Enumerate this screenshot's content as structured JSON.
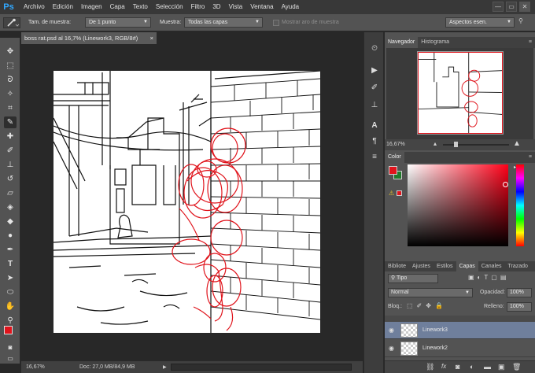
{
  "menubar": {
    "logo": "Ps",
    "items": [
      "Archivo",
      "Edición",
      "Imagen",
      "Capa",
      "Texto",
      "Selección",
      "Filtro",
      "3D",
      "Vista",
      "Ventana",
      "Ayuda"
    ],
    "minimize": "—",
    "restore": "▭",
    "close": "✕"
  },
  "options": {
    "sample_size_label": "Tam. de muestra:",
    "sample_size_value": "De 1 punto",
    "sample_label": "Muestra:",
    "sample_value": "Todas las capas",
    "show_ring_label": "Mostrar aro de muestra",
    "workspace_value": "Aspectos esen."
  },
  "document": {
    "tab_title": "boss rat.psd al 16,7% (Linework3, RGB/8#)",
    "tab_close": "×",
    "zoom": "16,67%",
    "doc_info": "Doc: 27,0 MB/84,9 MB",
    "status_arrow": "▶"
  },
  "navigator": {
    "tabs": [
      "Navegador",
      "Histograma"
    ],
    "zoom": "16,67%"
  },
  "color": {
    "tab": "Color",
    "foreground": "#e0141c",
    "background": "#207a2c"
  },
  "layers": {
    "tabs": [
      "Bibliote",
      "Ajustes",
      "Estilos",
      "Capas",
      "Canales",
      "Trazado"
    ],
    "active_tab": "Capas",
    "filter_value": "Tipo",
    "blend_mode": "Normal",
    "opacity_label": "Opacidad:",
    "opacity_value": "100%",
    "lock_label": "Bloq.:",
    "fill_label": "Relleno:",
    "fill_value": "100%",
    "items": [
      {
        "name": "Linework3",
        "selected": true
      },
      {
        "name": "Linework2",
        "selected": false
      }
    ],
    "footer_icons": [
      "link-icon",
      "fx-icon",
      "mask-icon",
      "adjustment-icon",
      "group-icon",
      "new-layer-icon",
      "trash-icon"
    ]
  },
  "colors": {
    "accent": "#31a8ff",
    "sketch_red": "#e0141c",
    "selected_layer": "#6f7f9c"
  }
}
